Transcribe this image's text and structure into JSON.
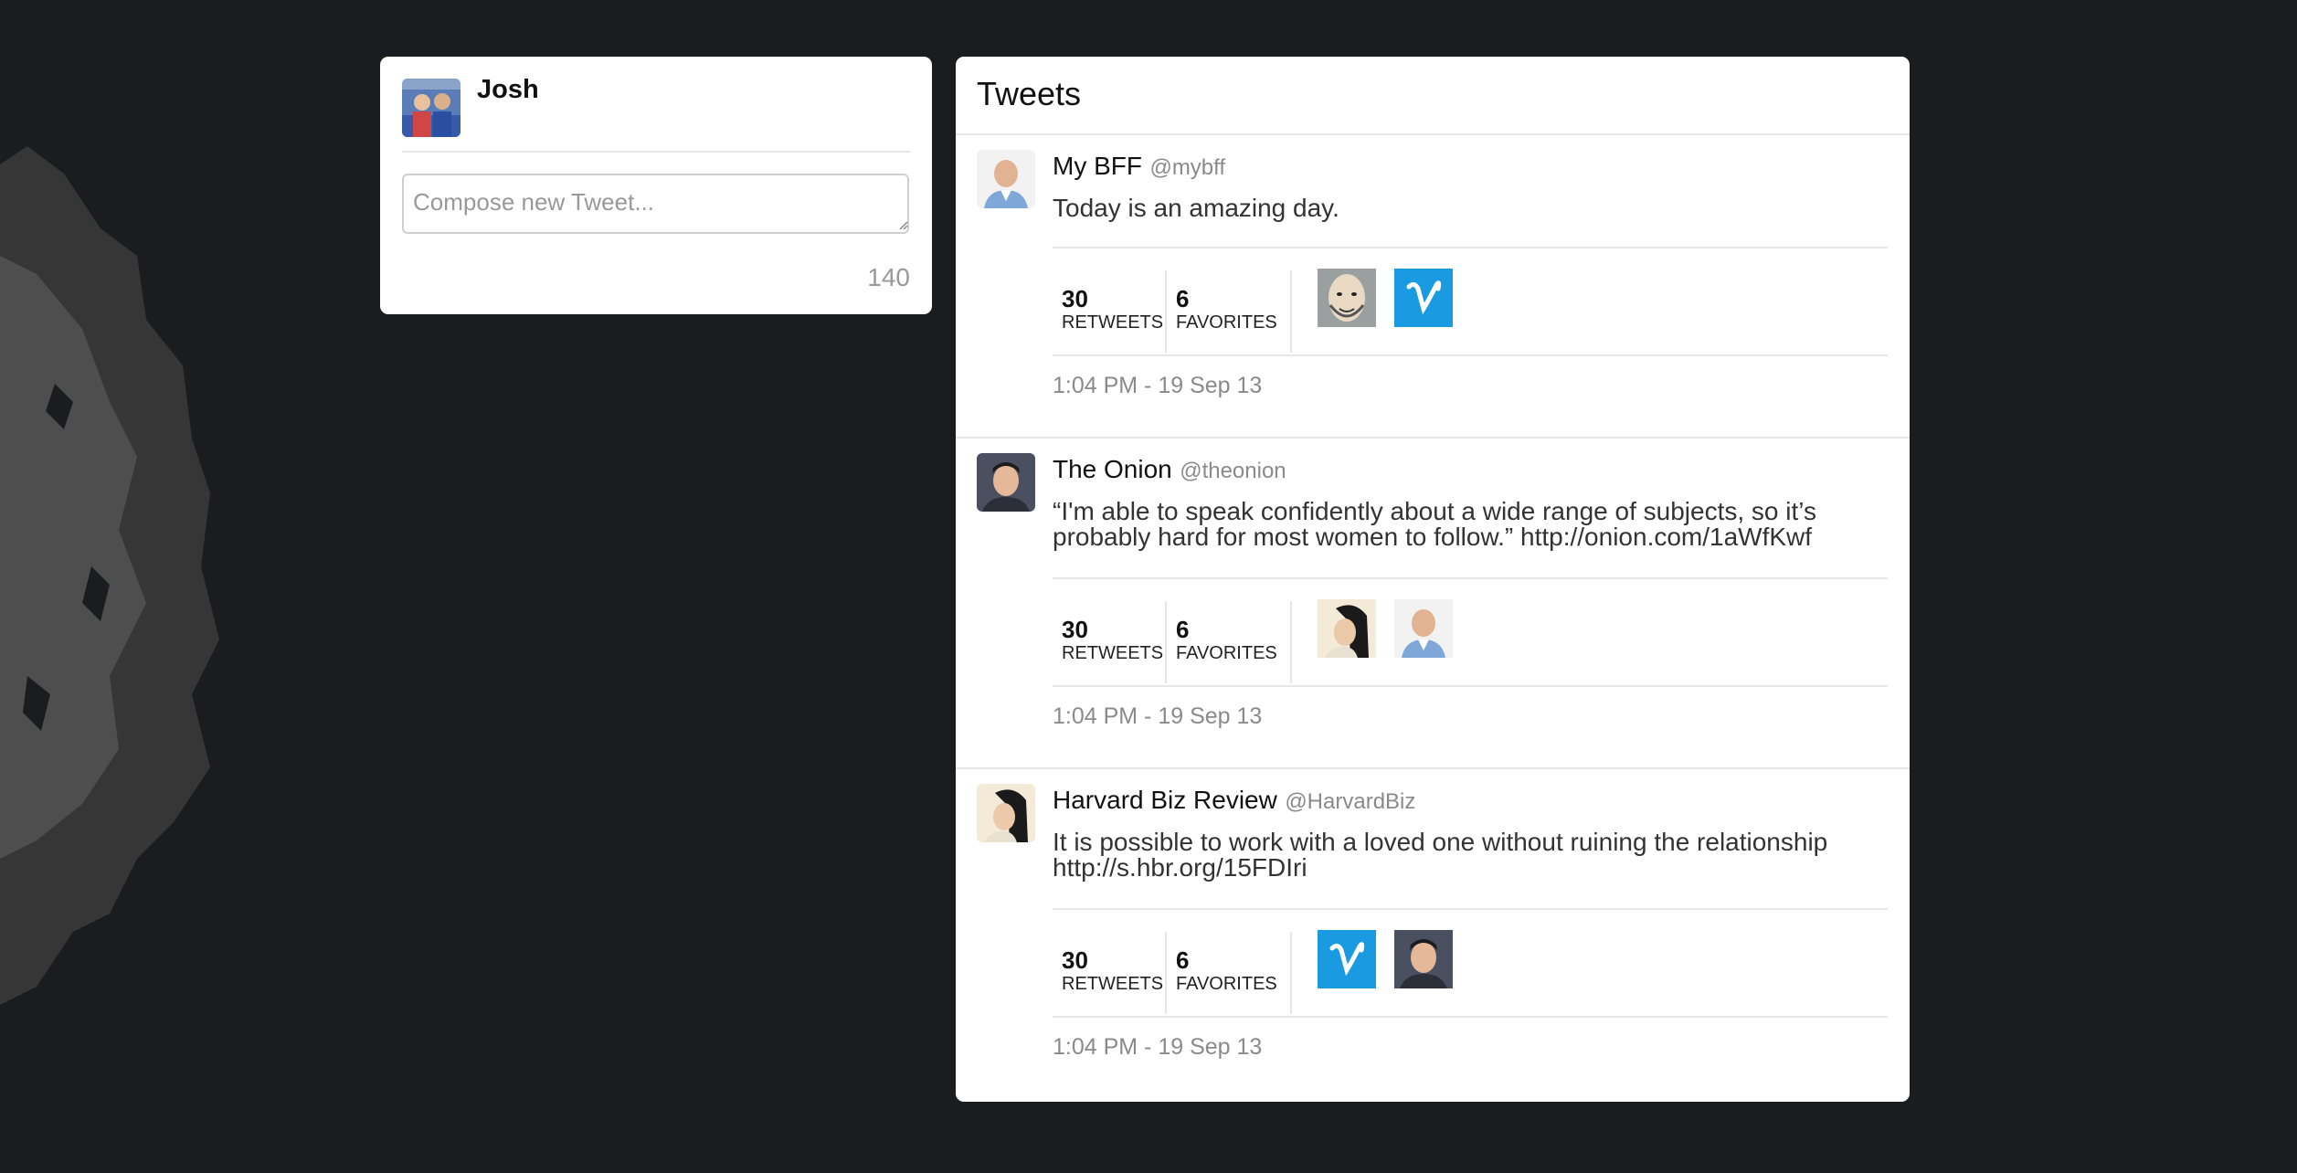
{
  "compose": {
    "user_name": "Josh",
    "placeholder": "Compose new Tweet...",
    "char_count": "140"
  },
  "tweets_panel": {
    "title": "Tweets",
    "items": [
      {
        "name": "My BFF",
        "handle": "@mybff",
        "text": "Today is an amazing day.",
        "retweets": "30",
        "retweets_label": "RETWEETS",
        "favorites": "6",
        "favorites_label": "FAVORITES",
        "timestamp": "1:04 PM - 19 Sep 13",
        "avatar": "bald-man",
        "mini_avatars": [
          "sketch-face",
          "vimeo-logo"
        ]
      },
      {
        "name": "The Onion",
        "handle": "@theonion",
        "text": "“I'm able to speak confidently about a wide range of subjects, so it’s probably hard for most women to follow.” http://onion.com/1aWfKwf",
        "retweets": "30",
        "retweets_label": "RETWEETS",
        "favorites": "6",
        "favorites_label": "FAVORITES",
        "timestamp": "1:04 PM - 19 Sep 13",
        "avatar": "young-man",
        "mini_avatars": [
          "woman-face",
          "bald-man"
        ]
      },
      {
        "name": "Harvard Biz Review",
        "handle": "@HarvardBiz",
        "text": "It is possible to work with a loved one without ruining the relationship http://s.hbr.org/15FDIri",
        "retweets": "30",
        "retweets_label": "RETWEETS",
        "favorites": "6",
        "favorites_label": "FAVORITES",
        "timestamp": "1:04 PM - 19 Sep 13",
        "avatar": "woman-face",
        "mini_avatars": [
          "vimeo-logo",
          "young-man"
        ]
      }
    ]
  },
  "colors": {
    "background": "#1b1c20",
    "panel": "#ffffff",
    "divider": "#e6e6e6",
    "muted_text": "#8a8a8a",
    "vimeo_blue": "#1a9ae0"
  }
}
